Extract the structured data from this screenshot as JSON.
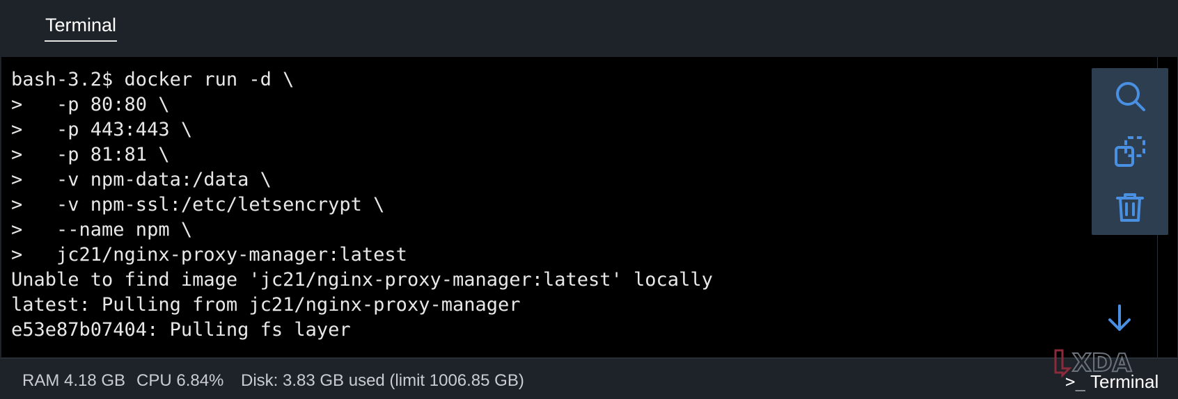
{
  "tabs": [
    {
      "label": "Terminal"
    }
  ],
  "terminal": {
    "lines": [
      "bash-3.2$ docker run -d \\",
      ">   -p 80:80 \\",
      ">   -p 443:443 \\",
      ">   -p 81:81 \\",
      ">   -v npm-data:/data \\",
      ">   -v npm-ssl:/etc/letsencrypt \\",
      ">   --name npm \\",
      ">   jc21/nginx-proxy-manager:latest",
      "Unable to find image 'jc21/nginx-proxy-manager:latest' locally",
      "latest: Pulling from jc21/nginx-proxy-manager",
      "e53e87b07404: Pulling fs layer"
    ],
    "text_color": "#e8e8e8",
    "background": "#000000"
  },
  "toolbar": {
    "icons": [
      "search-icon",
      "copy-icon",
      "trash-icon"
    ],
    "icon_color": "#4a90e2",
    "background": "#2c3e50"
  },
  "scroll_down": {
    "icon": "arrow-down-icon"
  },
  "status": {
    "ram": "RAM 4.18 GB",
    "cpu": "CPU 6.84%",
    "disk": "Disk: 3.83 GB used (limit 1006.85 GB)"
  },
  "watermark": {
    "brand": "XDA",
    "prompt": ">_",
    "label": "Terminal"
  }
}
